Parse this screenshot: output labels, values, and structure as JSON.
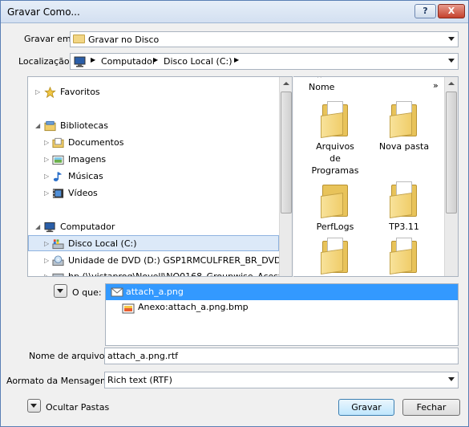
{
  "window": {
    "title": "Gravar Como...",
    "help_glyph": "?",
    "close_glyph": "X"
  },
  "save_in": {
    "label": "Gravar em:",
    "value": "Gravar no Disco"
  },
  "location": {
    "label": "Localização:",
    "crumbs": [
      "Computador",
      "Disco Local (C:)"
    ],
    "separator": "▶"
  },
  "tree": {
    "favoritos": "Favoritos",
    "bibliotecas": "Bibliotecas",
    "documentos": "Documentos",
    "imagens": "Imagens",
    "musicas": "Músicas",
    "videos": "Vídeos",
    "computador": "Computador",
    "disco_local": "Disco Local (C:)",
    "dvd": "Unidade de DVD (D:) GSP1RMCULFRER_BR_DVD",
    "network_partial": "hp (\\\\vistaprog\\Novell\\NO0168_Groupwise_Acest"
  },
  "files": {
    "column_header": "Nome",
    "more_glyph": "»",
    "items": [
      "Arquivos de Programas",
      "Nova pasta",
      "PerfLogs",
      "TP3.11"
    ]
  },
  "what": {
    "label": "O que:",
    "items": [
      "attach_a.png",
      "Anexo:attach_a.png.bmp"
    ]
  },
  "filename": {
    "label": "Nome de arquivo:",
    "value": "attach_a.png.rtf"
  },
  "format": {
    "label": "Aormato da Mensagem:",
    "value": "Rich text (RTF)"
  },
  "hide_folders_label": "Ocultar Pastas",
  "buttons": {
    "save": "Gravar",
    "close": "Fechar"
  },
  "colors": {
    "selection": "#3399ff",
    "folder": "#f0cd6a",
    "title_gradient_top": "#e6eef8"
  }
}
